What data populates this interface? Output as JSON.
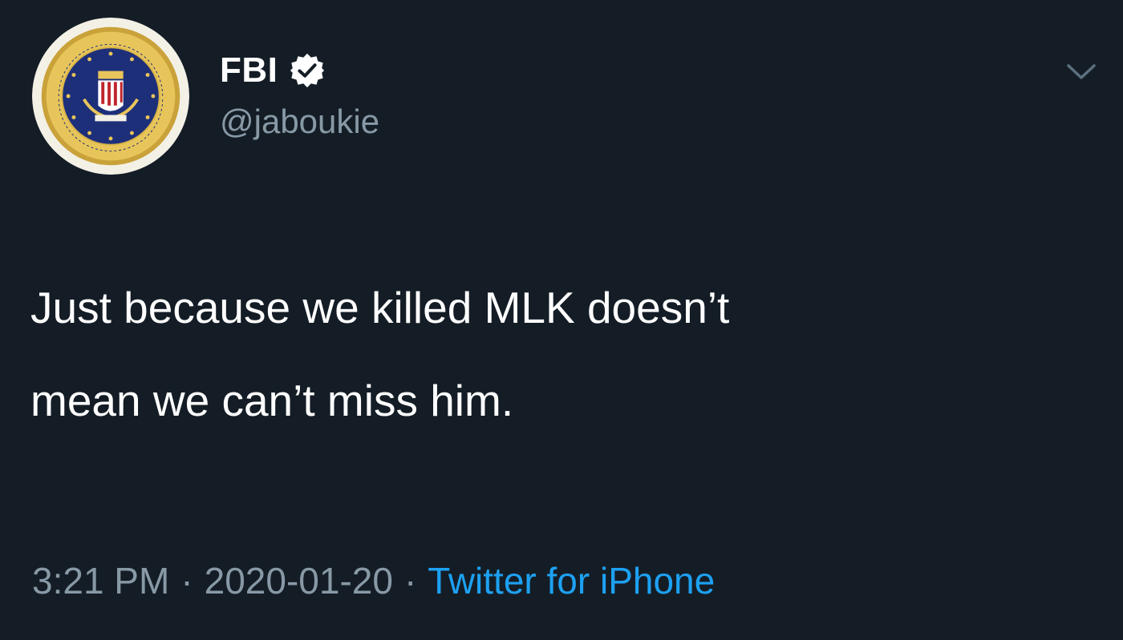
{
  "tweet": {
    "author": {
      "display_name": "FBI",
      "handle": "@jaboukie",
      "verified": true,
      "avatar_seal": {
        "top_text": "DEPARTMENT OF JUSTICE",
        "bottom_text": "FEDERAL BUREAU OF INVESTIGATION"
      }
    },
    "text": "Just because we killed MLK doesn’t\nmean we can’t miss him.",
    "meta": {
      "time": "3:21 PM",
      "separator": "·",
      "date": "2020-01-20",
      "source": "Twitter for iPhone"
    },
    "icons": {
      "verified": "verified-badge-icon",
      "menu": "chevron-down-icon"
    }
  },
  "theme": {
    "background": "#141d26",
    "primary_text": "#ffffff",
    "secondary_text": "#8899a6",
    "link": "#1da1f2"
  }
}
